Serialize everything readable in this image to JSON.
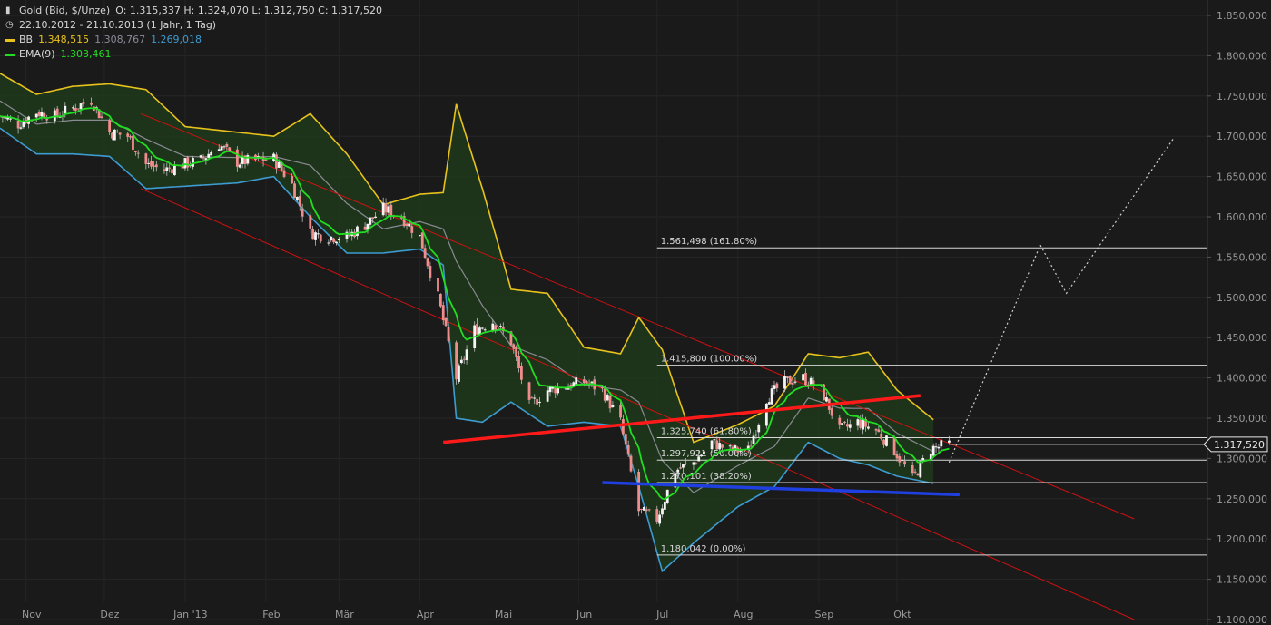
{
  "header": {
    "title": "Gold (Bid, $/Unze)",
    "ohlc": "O: 1.315,337  H: 1.324,070  L: 1.312,750  C: 1.317,520",
    "period": "22.10.2012 - 21.10.2013 (1 Jahr, 1 Tag)"
  },
  "legend": {
    "bb_label": "BB",
    "bb_upper": "1.348,515",
    "bb_mid": "1.308,767",
    "bb_lower": "1.269,018",
    "ema_label": "EMA(9)",
    "ema_value": "1.303,461"
  },
  "colors": {
    "background": "#1a1a1a",
    "bb_upper": "#e8c21c",
    "bb_mid": "#8a8a92",
    "bb_lower": "#3d9bd0",
    "ema": "#22dd22",
    "bb_fill": "#1f3a1c",
    "channel": "#cc1111",
    "support_red": "#ff1a1a",
    "support_blue": "#1f3fe0",
    "candle_up": "#f4f4f4",
    "candle_down": "#f08c8c",
    "fib": "#d8d8d8",
    "axis_text": "#9a9a9a",
    "price_tag": "#e8e8e8"
  },
  "chart_data": {
    "type": "candlestick",
    "x_range": [
      "2012-10-22",
      "2013-10-21"
    ],
    "ylim": [
      1100,
      1850
    ],
    "y_ticks": [
      1850,
      1800,
      1750,
      1700,
      1650,
      1600,
      1550,
      1500,
      1450,
      1400,
      1350,
      1300,
      1250,
      1200,
      1150,
      1100
    ],
    "y_tick_labels": [
      "1.850,000",
      "1.800,000",
      "1.750,000",
      "1.700,000",
      "1.650,000",
      "1.600,000",
      "1.550,000",
      "1.500,000",
      "1.450,000",
      "1.400,000",
      "1.350,000",
      "1.300,000",
      "1.250,000",
      "1.200,000",
      "1.150,000",
      "1.100,000"
    ],
    "x_ticks": [
      {
        "label": "Nov",
        "date": "2012-11-01"
      },
      {
        "label": "Dez",
        "date": "2012-12-01"
      },
      {
        "label": "Jan '13",
        "date": "2013-01-01"
      },
      {
        "label": "Feb",
        "date": "2013-02-01"
      },
      {
        "label": "Mär",
        "date": "2013-03-01"
      },
      {
        "label": "Apr",
        "date": "2013-04-01"
      },
      {
        "label": "Mai",
        "date": "2013-05-01"
      },
      {
        "label": "Jun",
        "date": "2013-06-01"
      },
      {
        "label": "Jul",
        "date": "2013-07-01"
      },
      {
        "label": "Aug",
        "date": "2013-08-01"
      },
      {
        "label": "Sep",
        "date": "2013-09-01"
      },
      {
        "label": "Okt",
        "date": "2013-10-01"
      }
    ],
    "close_series": [
      [
        "2012-10-22",
        1725
      ],
      [
        "2012-10-29",
        1715
      ],
      [
        "2012-11-05",
        1730
      ],
      [
        "2012-11-12",
        1725
      ],
      [
        "2012-11-19",
        1735
      ],
      [
        "2012-11-26",
        1745
      ],
      [
        "2012-12-03",
        1705
      ],
      [
        "2012-12-10",
        1700
      ],
      [
        "2012-12-17",
        1665
      ],
      [
        "2012-12-24",
        1658
      ],
      [
        "2012-12-31",
        1665
      ],
      [
        "2013-01-07",
        1670
      ],
      [
        "2013-01-14",
        1690
      ],
      [
        "2013-01-21",
        1668
      ],
      [
        "2013-01-28",
        1670
      ],
      [
        "2013-02-04",
        1672
      ],
      [
        "2013-02-11",
        1640
      ],
      [
        "2013-02-18",
        1580
      ],
      [
        "2013-02-25",
        1575
      ],
      [
        "2013-03-04",
        1575
      ],
      [
        "2013-03-11",
        1590
      ],
      [
        "2013-03-18",
        1610
      ],
      [
        "2013-03-25",
        1600
      ],
      [
        "2013-04-01",
        1575
      ],
      [
        "2013-04-08",
        1500
      ],
      [
        "2013-04-15",
        1400
      ],
      [
        "2013-04-22",
        1460
      ],
      [
        "2013-04-29",
        1470
      ],
      [
        "2013-05-06",
        1445
      ],
      [
        "2013-05-13",
        1365
      ],
      [
        "2013-05-20",
        1385
      ],
      [
        "2013-05-27",
        1390
      ],
      [
        "2013-06-03",
        1395
      ],
      [
        "2013-06-10",
        1385
      ],
      [
        "2013-06-17",
        1345
      ],
      [
        "2013-06-24",
        1235
      ],
      [
        "2013-07-01",
        1225
      ],
      [
        "2013-07-08",
        1285
      ],
      [
        "2013-07-15",
        1295
      ],
      [
        "2013-07-22",
        1320
      ],
      [
        "2013-07-29",
        1310
      ],
      [
        "2013-08-05",
        1310
      ],
      [
        "2013-08-12",
        1375
      ],
      [
        "2013-08-19",
        1395
      ],
      [
        "2013-08-26",
        1400
      ],
      [
        "2013-09-02",
        1385
      ],
      [
        "2013-09-09",
        1335
      ],
      [
        "2013-09-16",
        1345
      ],
      [
        "2013-09-23",
        1335
      ],
      [
        "2013-09-30",
        1310
      ],
      [
        "2013-10-07",
        1275
      ],
      [
        "2013-10-14",
        1312
      ],
      [
        "2013-10-21",
        1317.52
      ]
    ],
    "series": [
      {
        "name": "BB",
        "values_last": 1348.515
      },
      {
        "name": "BB",
        "values_last": 1308.767
      },
      {
        "name": "BB",
        "values_last": 1269.018
      },
      {
        "name": "EMA(9)",
        "values_last": 1303.461
      }
    ],
    "bb_upper_series": [
      [
        "2012-10-22",
        1778
      ],
      [
        "2012-11-05",
        1752
      ],
      [
        "2012-11-19",
        1762
      ],
      [
        "2012-12-03",
        1765
      ],
      [
        "2012-12-17",
        1758
      ],
      [
        "2013-01-01",
        1712
      ],
      [
        "2013-01-21",
        1705
      ],
      [
        "2013-02-04",
        1700
      ],
      [
        "2013-02-18",
        1728
      ],
      [
        "2013-03-04",
        1678
      ],
      [
        "2013-03-18",
        1615
      ],
      [
        "2013-04-01",
        1628
      ],
      [
        "2013-04-10",
        1630
      ],
      [
        "2013-04-15",
        1740
      ],
      [
        "2013-04-25",
        1635
      ],
      [
        "2013-05-06",
        1510
      ],
      [
        "2013-05-20",
        1505
      ],
      [
        "2013-06-03",
        1438
      ],
      [
        "2013-06-17",
        1430
      ],
      [
        "2013-06-24",
        1475
      ],
      [
        "2013-07-03",
        1435
      ],
      [
        "2013-07-15",
        1320
      ],
      [
        "2013-08-01",
        1342
      ],
      [
        "2013-08-15",
        1365
      ],
      [
        "2013-08-28",
        1430
      ],
      [
        "2013-09-09",
        1425
      ],
      [
        "2013-09-20",
        1432
      ],
      [
        "2013-10-01",
        1385
      ],
      [
        "2013-10-15",
        1348
      ]
    ],
    "bb_lower_series": [
      [
        "2012-10-22",
        1710
      ],
      [
        "2012-11-05",
        1678
      ],
      [
        "2012-11-19",
        1678
      ],
      [
        "2012-12-03",
        1675
      ],
      [
        "2012-12-17",
        1635
      ],
      [
        "2013-01-01",
        1638
      ],
      [
        "2013-01-21",
        1642
      ],
      [
        "2013-02-04",
        1650
      ],
      [
        "2013-02-18",
        1600
      ],
      [
        "2013-03-04",
        1555
      ],
      [
        "2013-03-18",
        1555
      ],
      [
        "2013-04-01",
        1560
      ],
      [
        "2013-04-10",
        1540
      ],
      [
        "2013-04-15",
        1350
      ],
      [
        "2013-04-25",
        1345
      ],
      [
        "2013-05-06",
        1370
      ],
      [
        "2013-05-20",
        1340
      ],
      [
        "2013-06-03",
        1345
      ],
      [
        "2013-06-17",
        1340
      ],
      [
        "2013-06-24",
        1265
      ],
      [
        "2013-07-03",
        1160
      ],
      [
        "2013-07-15",
        1195
      ],
      [
        "2013-08-01",
        1240
      ],
      [
        "2013-08-15",
        1265
      ],
      [
        "2013-08-28",
        1320
      ],
      [
        "2013-09-09",
        1300
      ],
      [
        "2013-09-20",
        1292
      ],
      [
        "2013-10-01",
        1278
      ],
      [
        "2013-10-15",
        1269
      ]
    ],
    "trend_channel": [
      {
        "from": [
          "2012-12-15",
          1728
        ],
        "to": [
          "2013-12-31",
          1225
        ]
      },
      {
        "from": [
          "2012-12-15",
          1635
        ],
        "to": [
          "2013-12-31",
          1100
        ]
      }
    ],
    "support_lines": [
      {
        "color": "red",
        "from": [
          "2013-04-10",
          1320
        ],
        "to": [
          "2013-10-10",
          1378
        ]
      },
      {
        "color": "blue",
        "from": [
          "2013-06-10",
          1270
        ],
        "to": [
          "2013-10-25",
          1255
        ]
      }
    ],
    "projection": [
      [
        "2013-10-21",
        1295
      ],
      [
        "2013-11-25",
        1565
      ],
      [
        "2013-12-05",
        1505
      ],
      [
        "2014-01-15",
        1697
      ]
    ],
    "fibonacci": [
      {
        "label": "1.561,498 (161.80%)",
        "value": 1561.498
      },
      {
        "label": "1.415,800 (100.00%)",
        "value": 1415.8
      },
      {
        "label": "1.325,740 (61.80%)",
        "value": 1325.74
      },
      {
        "label": "1.297,921 (50.00%)",
        "value": 1297.921
      },
      {
        "label": "1.270,101 (38.20%)",
        "value": 1270.101
      },
      {
        "label": "1.180,042 (0.00%)",
        "value": 1180.042
      }
    ],
    "last_price": 1317.52,
    "last_price_label": "1.317,520"
  }
}
